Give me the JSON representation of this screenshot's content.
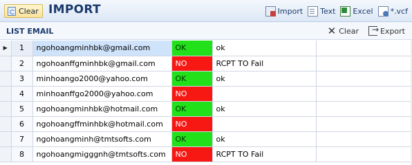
{
  "toolbar": {
    "clear_label": "Clear",
    "title": "IMPORT",
    "import_label": "Import",
    "text_label": "Text",
    "excel_label": "Excel",
    "vcf_label": "*.vcf"
  },
  "list": {
    "title": "LIST EMAIL",
    "clear_label": "Clear",
    "export_label": "Export"
  },
  "colors": {
    "ok": "#22e11b",
    "no": "#f71813",
    "selected": "#cfe3fb"
  },
  "rows": [
    {
      "num": "1",
      "email": "ngohoangminhbk@gmail.com",
      "status": "OK",
      "message": "ok"
    },
    {
      "num": "2",
      "email": "ngohoanffgminhbk@gmail.com",
      "status": "NO",
      "message": "RCPT TO Fail"
    },
    {
      "num": "3",
      "email": "minhoango2000@yahoo.com",
      "status": "OK",
      "message": "ok"
    },
    {
      "num": "4",
      "email": "minhoanffgo2000@yahoo.com",
      "status": "NO",
      "message": ""
    },
    {
      "num": "5",
      "email": "ngohoangminhbk@hotmail.com",
      "status": "OK",
      "message": "ok"
    },
    {
      "num": "6",
      "email": "ngohoangffminhbk@hotmail.com",
      "status": "NO",
      "message": ""
    },
    {
      "num": "7",
      "email": "ngohoangminh@tmtsofts.com",
      "status": "OK",
      "message": "ok"
    },
    {
      "num": "8",
      "email": "ngohoangmigggnh@tmtsofts.com",
      "status": "NO",
      "message": "RCPT TO Fail"
    }
  ]
}
